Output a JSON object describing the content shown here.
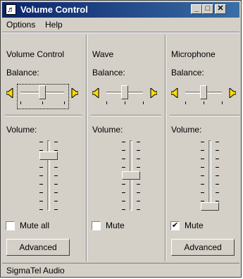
{
  "window": {
    "title": "Volume Control",
    "app_icon": "volume-control-icon"
  },
  "titlebar_buttons": {
    "minimize": "_",
    "maximize": "□",
    "close": "✕"
  },
  "menu": [
    {
      "label": "Options",
      "accel": "p"
    },
    {
      "label": "Help",
      "accel": "H"
    }
  ],
  "channels": [
    {
      "name": "Volume Control",
      "balance_label": "Balance:",
      "volume_label": "Volume:",
      "balance": 0.5,
      "volume": 0.82,
      "mute_label": "Mute all",
      "muted": false,
      "advanced_label": "Advanced"
    },
    {
      "name": "Wave",
      "balance_label": "Balance:",
      "volume_label": "Volume:",
      "balance": 0.5,
      "volume": 0.5,
      "mute_label": "Mute",
      "muted": false
    },
    {
      "name": "Microphone",
      "balance_label": "Balance:",
      "volume_label": "Volume:",
      "balance": 0.5,
      "volume": 0.0,
      "mute_label": "Mute",
      "muted": true,
      "advanced_label": "Advanced"
    }
  ],
  "status": {
    "device": "SigmaTel Audio"
  }
}
